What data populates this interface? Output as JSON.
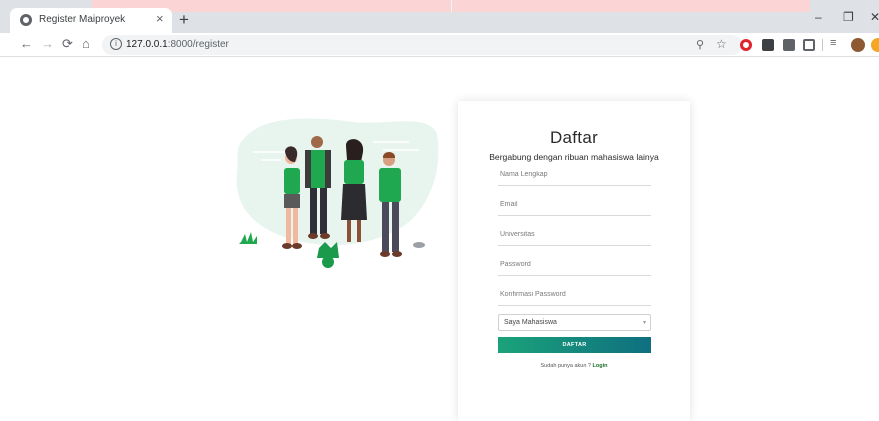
{
  "browser": {
    "tab_title": "Register Maiproyek",
    "tab_close": "×",
    "new_tab": "+",
    "url_host": "127.0.0.1",
    "url_rest": ":8000/register",
    "controls": {
      "minimize": "–",
      "maximize": "❐",
      "close": "✕"
    }
  },
  "register": {
    "title": "Daftar",
    "subtitle": "Bergabung dengan ribuan mahasiswa lainya",
    "fields": {
      "full_name_placeholder": "Nama Lengkap",
      "email_placeholder": "Email",
      "university_placeholder": "Universitas",
      "password_placeholder": "Password",
      "confirm_password_placeholder": "Konfirmasi Password"
    },
    "role_select": {
      "selected": "Saya Mahasiswa"
    },
    "submit_label": "DAFTAR",
    "login_prompt": "Sudah punya akun ?",
    "login_link": "Login"
  },
  "colors": {
    "accent_green": "#1aa37a",
    "accent_teal": "#0f6f80",
    "illustration_green": "#1fa84f",
    "illustration_blob": "#e6f4ec"
  }
}
